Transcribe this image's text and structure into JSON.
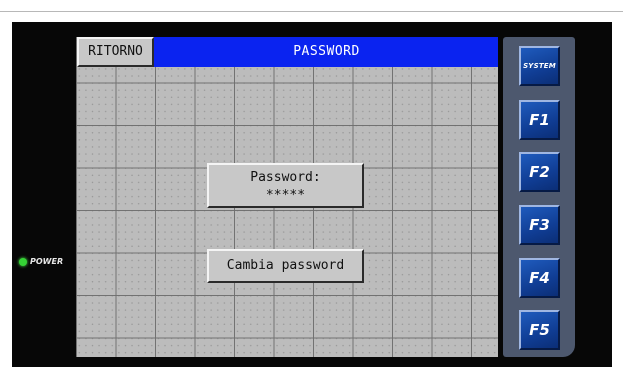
{
  "header": {
    "back_label": "RITORNO",
    "title": "PASSWORD"
  },
  "main": {
    "password_label": "Password:",
    "password_value": "*****",
    "change_password_label": "Cambia password"
  },
  "function_keys": [
    "SYSTEM",
    "F1",
    "F2",
    "F3",
    "F4",
    "F5"
  ],
  "power": {
    "label": "POWER",
    "led_color": "#35d235"
  },
  "colors": {
    "header": "#0a23f0",
    "screen": "#bcbcbc",
    "fkey": "#103d94"
  }
}
